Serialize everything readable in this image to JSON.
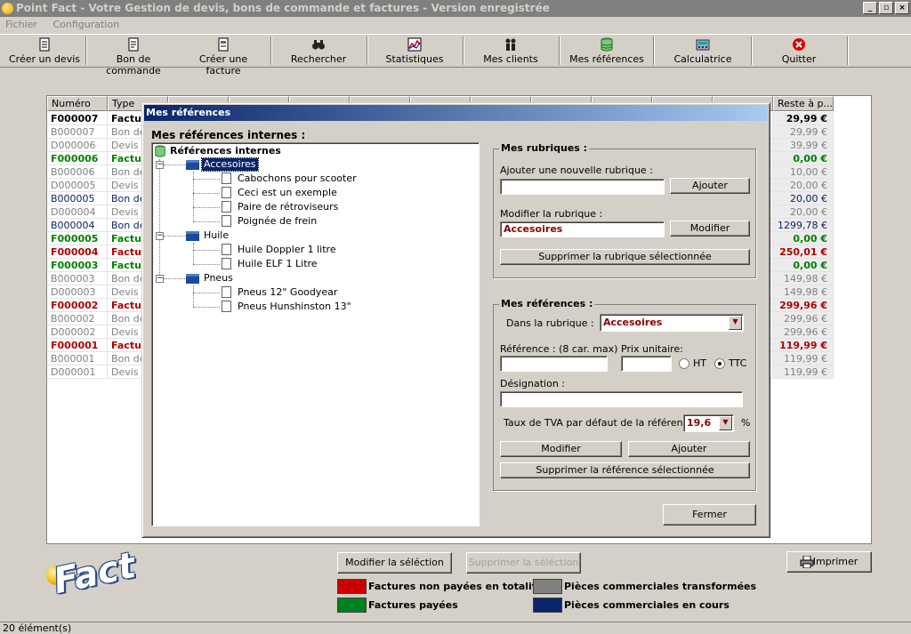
{
  "window": {
    "title": "Point Fact - Votre Gestion de devis, bons de commande et factures - Version enregistrée"
  },
  "menu": [
    "Fichier",
    "Configuration"
  ],
  "toolbar": [
    {
      "label": "Créer un devis",
      "icon": "quote-doc-icon"
    },
    {
      "label": "Bon de commande",
      "icon": "order-doc-icon"
    },
    {
      "label": "Créer une facture",
      "icon": "invoice-doc-icon"
    },
    {
      "label": "Rechercher",
      "icon": "binoculars-icon"
    },
    {
      "label": "Statistiques",
      "icon": "chart-icon"
    },
    {
      "label": "Mes clients",
      "icon": "people-icon"
    },
    {
      "label": "Mes références",
      "icon": "database-icon"
    },
    {
      "label": "Calculatrice",
      "icon": "calculator-icon"
    },
    {
      "label": "Quitter",
      "icon": "quit-icon"
    }
  ],
  "grid": {
    "headers": {
      "numero": "Numéro",
      "type": "Type",
      "reste": "Reste à p..."
    },
    "rows": [
      {
        "numero": "F000007",
        "type": "Factur",
        "reste": "29,99 €",
        "color": "#000000",
        "bold": true
      },
      {
        "numero": "B000007",
        "type": "Bon de",
        "reste": "29,99 €",
        "color": "#808080",
        "bold": false
      },
      {
        "numero": "D000006",
        "type": "Devis",
        "reste": "39,99 €",
        "color": "#808080",
        "bold": false
      },
      {
        "numero": "F000006",
        "type": "Factur",
        "reste": "0,00 €",
        "color": "#008000",
        "bold": true
      },
      {
        "numero": "B000006",
        "type": "Bon de",
        "reste": "10,00 €",
        "color": "#808080",
        "bold": false
      },
      {
        "numero": "D000005",
        "type": "Devis",
        "reste": "20,00 €",
        "color": "#808080",
        "bold": false
      },
      {
        "numero": "B000005",
        "type": "Bon de",
        "reste": "20,00 €",
        "color": "#0a246a",
        "bold": false
      },
      {
        "numero": "D000004",
        "type": "Devis",
        "reste": "20,00 €",
        "color": "#808080",
        "bold": false
      },
      {
        "numero": "B000004",
        "type": "Bon de",
        "reste": "1299,78 €",
        "color": "#0a246a",
        "bold": false
      },
      {
        "numero": "F000005",
        "type": "Factur",
        "reste": "0,00 €",
        "color": "#008000",
        "bold": true
      },
      {
        "numero": "F000004",
        "type": "Factur",
        "reste": "250,01 €",
        "color": "#b00000",
        "bold": true
      },
      {
        "numero": "F000003",
        "type": "Factur",
        "reste": "0,00 €",
        "color": "#008000",
        "bold": true
      },
      {
        "numero": "B000003",
        "type": "Bon de",
        "reste": "149,98 €",
        "color": "#808080",
        "bold": false
      },
      {
        "numero": "D000003",
        "type": "Devis",
        "reste": "149,98 €",
        "color": "#808080",
        "bold": false
      },
      {
        "numero": "F000002",
        "type": "Factur",
        "reste": "299,96 €",
        "color": "#b00000",
        "bold": true
      },
      {
        "numero": "B000002",
        "type": "Bon de",
        "reste": "299,96 €",
        "color": "#808080",
        "bold": false
      },
      {
        "numero": "D000002",
        "type": "Devis",
        "reste": "299,96 €",
        "color": "#808080",
        "bold": false
      },
      {
        "numero": "F000001",
        "type": "Factur",
        "reste": "119,99 €",
        "color": "#b00000",
        "bold": true
      },
      {
        "numero": "B000001",
        "type": "Bon de",
        "reste": "119,99 €",
        "color": "#808080",
        "bold": false
      },
      {
        "numero": "D000001",
        "type": "Devis",
        "reste": "119,99 €",
        "color": "#808080",
        "bold": false
      }
    ]
  },
  "dialog": {
    "title": "Mes références",
    "tree_heading": "Mes références internes :",
    "tree": {
      "root": "Références internes",
      "folders": [
        {
          "name": "Accesoires",
          "selected": true,
          "items": [
            "Cabochons pour scooter",
            "Ceci est un exemple",
            "Paire de rétroviseurs",
            "Poignée de frein"
          ]
        },
        {
          "name": "Huile",
          "selected": false,
          "items": [
            "Huile Doppler 1 litre",
            "Huile ELF 1 Litre"
          ]
        },
        {
          "name": "Pneus",
          "selected": false,
          "items": [
            "Pneus 12\" Goodyear",
            "Pneus Hunshinston 13\""
          ]
        }
      ]
    },
    "rubriques": {
      "legend": "Mes rubriques :",
      "add_label": "Ajouter une nouvelle rubrique :",
      "add_value": "",
      "add_button": "Ajouter",
      "modify_label": "Modifier la rubrique :",
      "modify_value": "Accesoires",
      "modify_button": "Modifier",
      "delete_button": "Supprimer la rubrique sélectionnée"
    },
    "references": {
      "legend": "Mes références :",
      "rubrique_label": "Dans la rubrique :",
      "rubrique_value": "Accesoires",
      "ref_label": "Référence : (8 car. max)",
      "ref_value": "",
      "price_label": "Prix unitaire:",
      "price_value": "",
      "ht_label": "HT",
      "ttc_label": "TTC",
      "price_mode": "TTC",
      "designation_label": "Désignation :",
      "designation_value": "",
      "tva_label": "Taux de TVA par défaut de la référence:",
      "tva_value": "19,6",
      "tva_unit": "%",
      "modify_button": "Modifier",
      "add_button": "Ajouter",
      "delete_button": "Supprimer la référence sélectionnée"
    },
    "close_button": "Fermer"
  },
  "bottom": {
    "modify_selection": "Modifier la séléction",
    "delete_selection": "Supprimer la séléction",
    "print": "Imprimer",
    "logo_text": "Fact"
  },
  "legend": [
    {
      "label": "Factures non payées en totalité",
      "color": "#cc0000"
    },
    {
      "label": "Factures payées",
      "color": "#008020"
    },
    {
      "label": "Pièces commerciales transformées",
      "color": "#808080"
    },
    {
      "label": "Pièces commerciales en cours",
      "color": "#0a246a"
    }
  ],
  "status": {
    "text": "20 élément(s)"
  }
}
